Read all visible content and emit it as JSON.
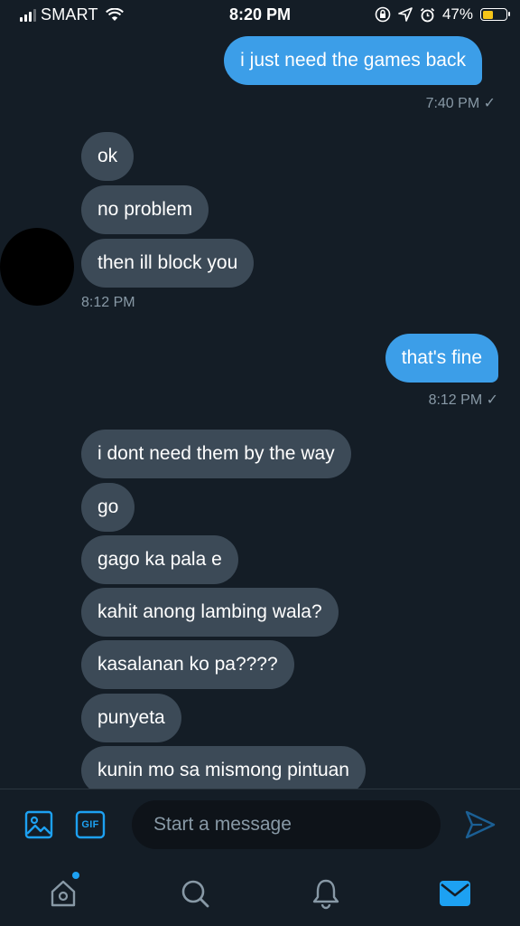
{
  "status_bar": {
    "carrier": "SMART",
    "time": "8:20 PM",
    "battery_percent": "47%",
    "battery_level": 0.47,
    "battery_color": "#f5c518"
  },
  "messages": [
    {
      "direction": "out",
      "text": "i just need the games back"
    },
    {
      "direction": "out_stamp",
      "text": "7:40 PM ✓"
    },
    {
      "direction": "in",
      "text": "ok"
    },
    {
      "direction": "in",
      "text": "no problem"
    },
    {
      "direction": "in",
      "text": "then ill block you"
    },
    {
      "direction": "in_stamp",
      "text": "8:12 PM"
    },
    {
      "direction": "out",
      "text": "that's fine"
    },
    {
      "direction": "out_stamp",
      "text": "8:12 PM ✓"
    },
    {
      "direction": "in",
      "text": "i dont need them by the way"
    },
    {
      "direction": "in",
      "text": "go"
    },
    {
      "direction": "in",
      "text": "gago ka pala e"
    },
    {
      "direction": "in",
      "text": "kahit anong lambing wala?"
    },
    {
      "direction": "in",
      "text": "kasalanan ko pa????"
    },
    {
      "direction": "in",
      "text": "punyeta"
    },
    {
      "direction": "in",
      "text": "kunin mo sa mismong pintuan"
    }
  ],
  "composer": {
    "placeholder": "Start a message",
    "gif_label": "GIF",
    "image_icon": "image-icon",
    "send_icon": "send-icon"
  },
  "nav": {
    "items": [
      "home-icon",
      "search-icon",
      "notifications-icon",
      "messages-icon"
    ],
    "active": "messages-icon"
  },
  "colors": {
    "background": "#141d26",
    "outgoing_bubble": "#3c9ee8",
    "incoming_bubble": "#3c4a57",
    "accent": "#1da1f2",
    "muted_text": "#8899a6"
  }
}
